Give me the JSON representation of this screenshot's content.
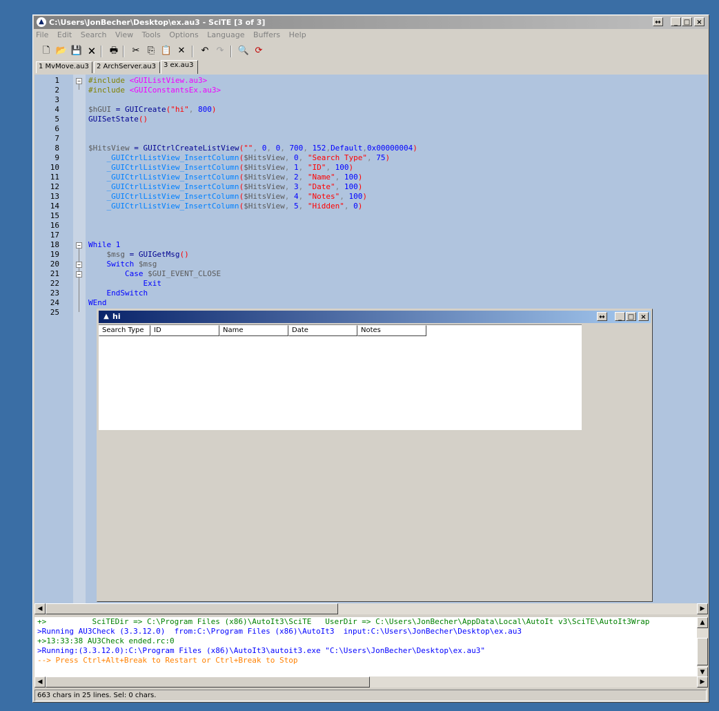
{
  "window": {
    "title": "C:\\Users\\JonBecher\\Desktop\\ex.au3 - SciTE [3 of 3]",
    "caption_buttons": [
      "↔",
      "_",
      "□",
      "×"
    ]
  },
  "menu": [
    "File",
    "Edit",
    "Search",
    "View",
    "Tools",
    "Options",
    "Language",
    "Buffers",
    "Help"
  ],
  "toolbar": {
    "new_icon": "🗋",
    "open_icon": "📂",
    "save_icon": "💾",
    "close_icon": "🗙",
    "print_icon": "🖶",
    "cut_icon": "✂",
    "copy_icon": "⎘",
    "paste_icon": "📋",
    "delete_icon": "✕",
    "undo_icon": "↶",
    "redo_icon": "↷",
    "find_icon": "🔍",
    "replace_icon": "⟳"
  },
  "tabs": [
    "1 MvMove.au3",
    "2 ArchServer.au3",
    "3 ex.au3"
  ],
  "editor": {
    "line_numbers": [
      "1",
      "2",
      "3",
      "4",
      "5",
      "6",
      "7",
      "8",
      "9",
      "10",
      "11",
      "12",
      "13",
      "14",
      "15",
      "16",
      "17",
      "18",
      "19",
      "20",
      "21",
      "22",
      "23",
      "24",
      "25"
    ],
    "lines": {
      "l1a": "#include ",
      "l1b": "<GUIListView.au3>",
      "l2a": "#include ",
      "l2b": "<GUIConstantsEx.au3>",
      "l4a": "$hGUI",
      "l4b": " = ",
      "l4c": "GUICreate",
      "l4d": "(",
      "l4e": "\"hi\"",
      "l4f": ", ",
      "l4g": "800",
      "l4h": ")",
      "l5a": "GUISetState",
      "l5b": "()",
      "l8a": "$HitsView",
      "l8b": " = ",
      "l8c": "GUICtrlCreateListView",
      "l8d": "(",
      "l8e": "\"\"",
      "l8f": ", ",
      "l8g": "0",
      "l8h": ", ",
      "l8i": "0",
      "l8j": ", ",
      "l8k": "700",
      "l8l": ", ",
      "l8m": "152",
      "l8n": ",",
      "l8o": "Default",
      "l8p": ",",
      "l8q": "0x00000004",
      "l8r": ")",
      "l9": [
        "_GUICtrlListView_InsertColumn",
        "$HitsView",
        "0",
        "\"Search Type\"",
        "75"
      ],
      "l10": [
        "_GUICtrlListView_InsertColumn",
        "$HitsView",
        "1",
        "\"ID\"",
        "100"
      ],
      "l11": [
        "_GUICtrlListView_InsertColumn",
        "$HitsView",
        "2",
        "\"Name\"",
        "100"
      ],
      "l12": [
        "_GUICtrlListView_InsertColumn",
        "$HitsView",
        "3",
        "\"Date\"",
        "100"
      ],
      "l13": [
        "_GUICtrlListView_InsertColumn",
        "$HitsView",
        "4",
        "\"Notes\"",
        "100"
      ],
      "l14": [
        "_GUICtrlListView_InsertColumn",
        "$HitsView",
        "5",
        "\"Hidden\"",
        "0"
      ],
      "l18a": "While",
      "l18b": " 1",
      "l19a": "$msg",
      "l19b": " = ",
      "l19c": "GUIGetMsg",
      "l19d": "()",
      "l20a": "Switch",
      "l20b": " $msg",
      "l21a": "Case",
      "l21b": " $GUI_EVENT_CLOSE",
      "l22": "Exit",
      "l23": "EndSwitch",
      "l24": "WEnd"
    }
  },
  "output": [
    {
      "text": "+>          SciTEDir => C:\\Program Files (x86)\\AutoIt3\\SciTE   UserDir => C:\\Users\\JonBecher\\AppData\\Local\\AutoIt v3\\SciTE\\AutoIt3Wrap",
      "color": "#008000"
    },
    {
      "text": ">Running AU3Check (3.3.12.0)  from:C:\\Program Files (x86)\\AutoIt3  input:C:\\Users\\JonBecher\\Desktop\\ex.au3",
      "color": "#0000ff"
    },
    {
      "text": "+>13:33:38 AU3Check ended.rc:0",
      "color": "#008000"
    },
    {
      "text": ">Running:(3.3.12.0):C:\\Program Files (x86)\\AutoIt3\\autoit3.exe \"C:\\Users\\JonBecher\\Desktop\\ex.au3\"",
      "color": "#0000ff"
    },
    {
      "text": "--> Press Ctrl+Alt+Break to Restart or Ctrl+Break to Stop",
      "color": "#ff8000"
    }
  ],
  "status": "663 chars in 25 lines. Sel: 0 chars.",
  "gui_window": {
    "title": "hi",
    "caption_buttons": [
      "↔",
      "_",
      "□",
      "×"
    ],
    "columns": [
      "Search Type",
      "ID",
      "Name",
      "Date",
      "Notes"
    ]
  }
}
